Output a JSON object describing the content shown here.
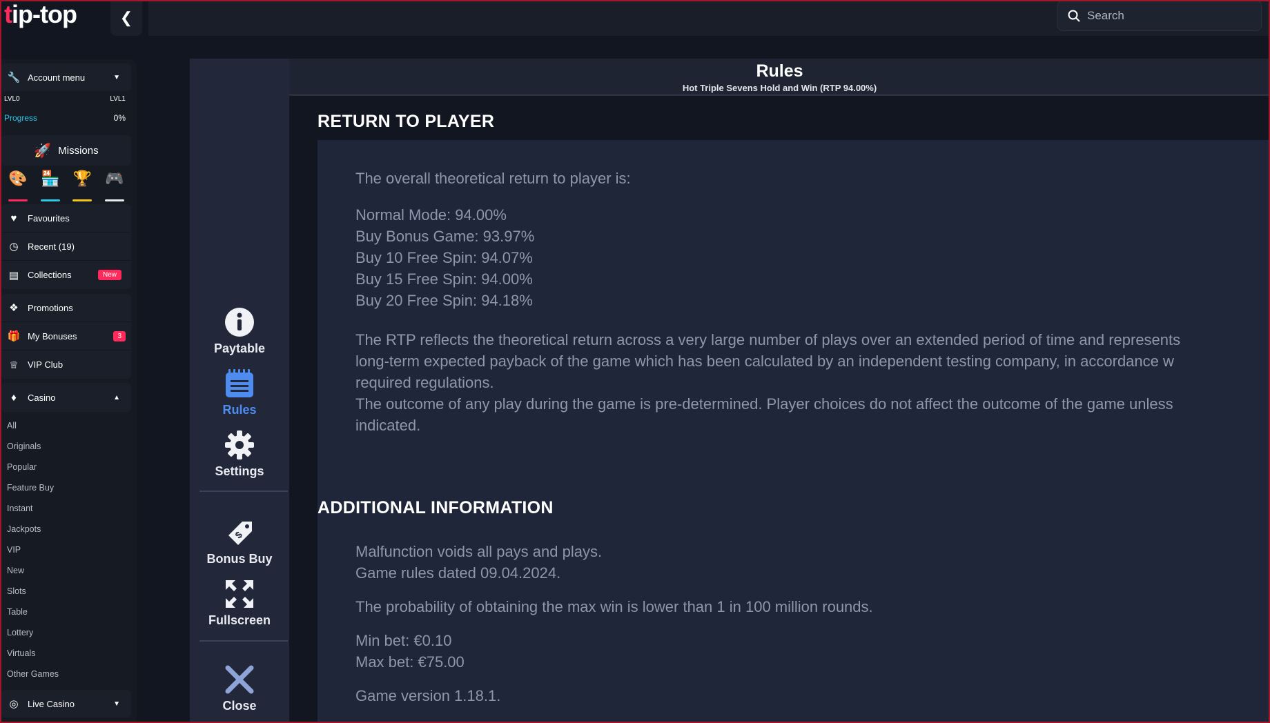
{
  "brand": {
    "logo_t": "t",
    "logo_rest": "ip-top"
  },
  "search": {
    "placeholder": "Search"
  },
  "sidebar": {
    "account_menu": "Account menu",
    "level_left": "LVL0",
    "level_right": "LVL1",
    "progress_label": "Progress",
    "progress_value": "0%",
    "missions": "Missions",
    "items1": [
      "Favourites",
      "Recent (19)",
      "Collections"
    ],
    "collections_badge": "New",
    "items2": [
      "Promotions",
      "My Bonuses",
      "VIP Club"
    ],
    "bonuses_badge": "3",
    "casino": "Casino",
    "casino_sub": [
      "All",
      "Originals",
      "Popular",
      "Feature Buy",
      "Instant",
      "Jackpots",
      "VIP",
      "New",
      "Slots",
      "Table",
      "Lottery",
      "Virtuals",
      "Other Games"
    ],
    "live_casino": "Live Casino",
    "colors": {
      "accent": "#ff2a5c",
      "progress": "#2fc6e8"
    }
  },
  "game_menu": {
    "paytable": "Paytable",
    "rules": "Rules",
    "settings": "Settings",
    "bonus_buy": "Bonus Buy",
    "fullscreen": "Fullscreen",
    "close": "Close",
    "active_color": "#4f8cf0"
  },
  "rules": {
    "title": "Rules",
    "subtitle": "Hot Triple Sevens Hold and Win (RTP 94.00%)",
    "rtp_heading": "RETURN TO PLAYER",
    "rtp_intro": "The overall theoretical return to player is:",
    "rtp_list": [
      "Normal Mode: 94.00%",
      "Buy Bonus Game: 93.97%",
      "Buy 10 Free Spin: 94.07%",
      "Buy 15 Free Spin: 94.00%",
      "Buy 20 Free Spin: 94.18%"
    ],
    "rtp_para1": [
      "The RTP reflects the theoretical return across a very large number of plays over an extended period of time and represents",
      "long-term expected payback of the game which has been calculated by an independent testing company, in accordance w",
      "required regulations."
    ],
    "rtp_para2": [
      "The outcome of any play during the game is pre-determined. Player choices do not affect the outcome of the game unless",
      "indicated."
    ],
    "add_heading": "ADDITIONAL INFORMATION",
    "add_line1": "Malfunction voids all pays and plays.",
    "add_line2": "Game rules dated 09.04.2024.",
    "add_line3": "The probability of obtaining the max win is lower than 1 in 100 million rounds.",
    "add_min": "Min bet: €0.10",
    "add_max": "Max bet: €75.00",
    "add_version": "Game version 1.18.1."
  }
}
